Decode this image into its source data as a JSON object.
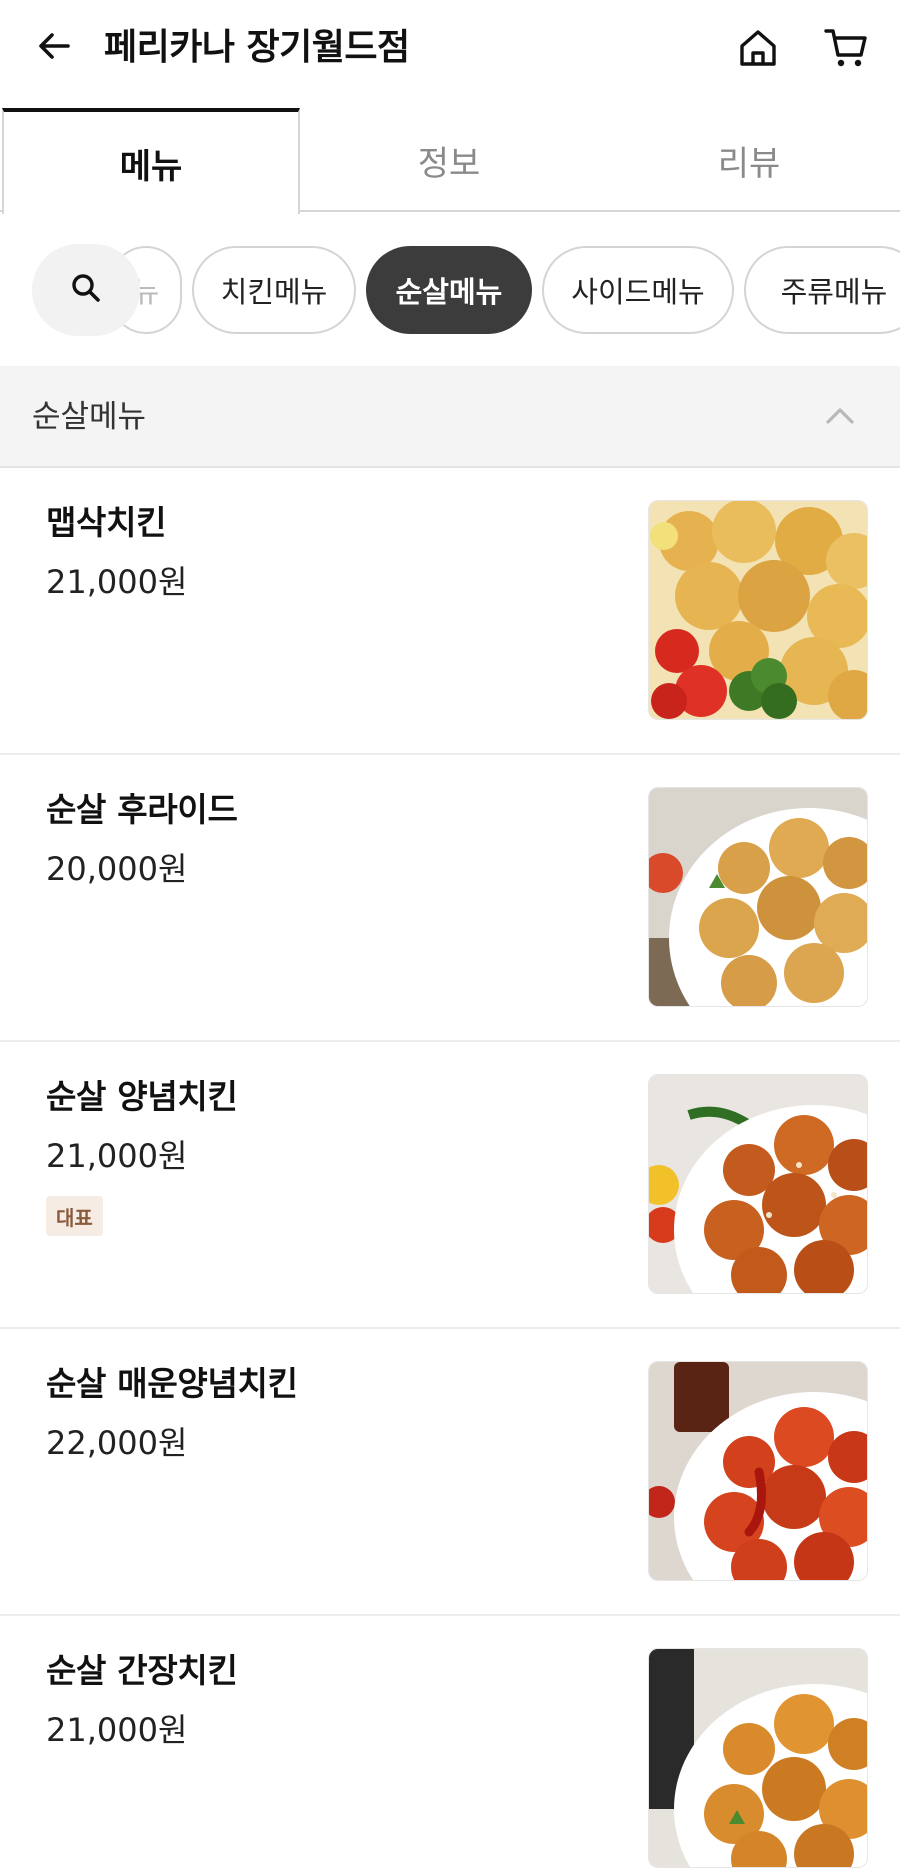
{
  "header": {
    "back_icon": "arrow-left-icon",
    "title": "페리카나 장기월드점",
    "home_icon": "home-icon",
    "cart_icon": "cart-icon"
  },
  "tabs": [
    {
      "label": "메뉴",
      "active": true
    },
    {
      "label": "정보",
      "active": false
    },
    {
      "label": "리뷰",
      "active": false
    }
  ],
  "categories": {
    "search_icon": "search-icon",
    "items": [
      {
        "label": "뉴",
        "active": false
      },
      {
        "label": "치킨메뉴",
        "active": false
      },
      {
        "label": "순살메뉴",
        "active": true
      },
      {
        "label": "사이드메뉴",
        "active": false
      },
      {
        "label": "주류메뉴",
        "active": false
      }
    ]
  },
  "section": {
    "title": "순살메뉴",
    "collapse_icon": "chevron-up-icon"
  },
  "menu_items": [
    {
      "name": "맵삭치킨",
      "price": "21,000원",
      "badge": null
    },
    {
      "name": "순살 후라이드",
      "price": "20,000원",
      "badge": null
    },
    {
      "name": "순살 양념치킨",
      "price": "21,000원",
      "badge": "대표"
    },
    {
      "name": "순살 매운양념치킨",
      "price": "22,000원",
      "badge": null
    },
    {
      "name": "순살 간장치킨",
      "price": "21,000원",
      "badge": null
    }
  ],
  "colors": {
    "active_chip": "#3c3c3c",
    "badge_bg": "#f6ece4",
    "badge_text": "#8a5a3c",
    "section_bg": "#f4f4f4"
  }
}
